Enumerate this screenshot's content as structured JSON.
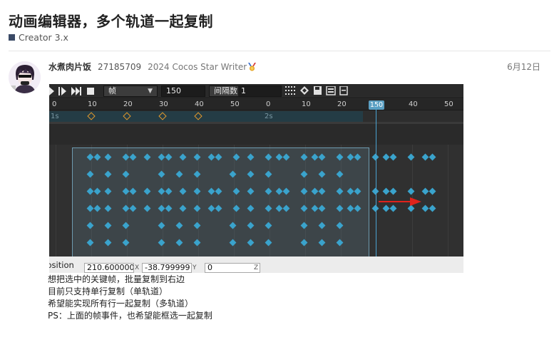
{
  "topic": {
    "title": "动画编辑器，多个轨道一起复制",
    "category": "Creator 3.x",
    "category_color": "#3a4a66"
  },
  "post": {
    "username": "水煮肉片饭",
    "user_id": "27185709",
    "user_title": "2024 Cocos Star Writer",
    "date": "6月12日",
    "body_lines": [
      "想把选中的关键帧，批量复制到右边",
      "目前只支持单行复制（单轨道）",
      "希望能实现所有行一起复制（多轨道）",
      "PS：上面的帧事件，也希望能框选一起复制"
    ]
  },
  "editor": {
    "unit_select": "帧",
    "frame_value": "150",
    "interval_label": "间隔数",
    "interval_value": "1",
    "ruler_ticks": [
      "0",
      "10",
      "20",
      "30",
      "40",
      "50",
      "0",
      "10",
      "20",
      "150",
      "40",
      "50"
    ],
    "second_labels": [
      "1s",
      "2s"
    ],
    "playhead_frame": "150",
    "property_label": "Position",
    "position_x": "210.600000",
    "position_y": "-38.799999",
    "position_z": "0",
    "axis_x": "X",
    "axis_y": "Y",
    "axis_z": "Z",
    "accent_color": "#3aa3cc",
    "event_color": "#e49a2c",
    "arrow_color": "#e0231b"
  }
}
